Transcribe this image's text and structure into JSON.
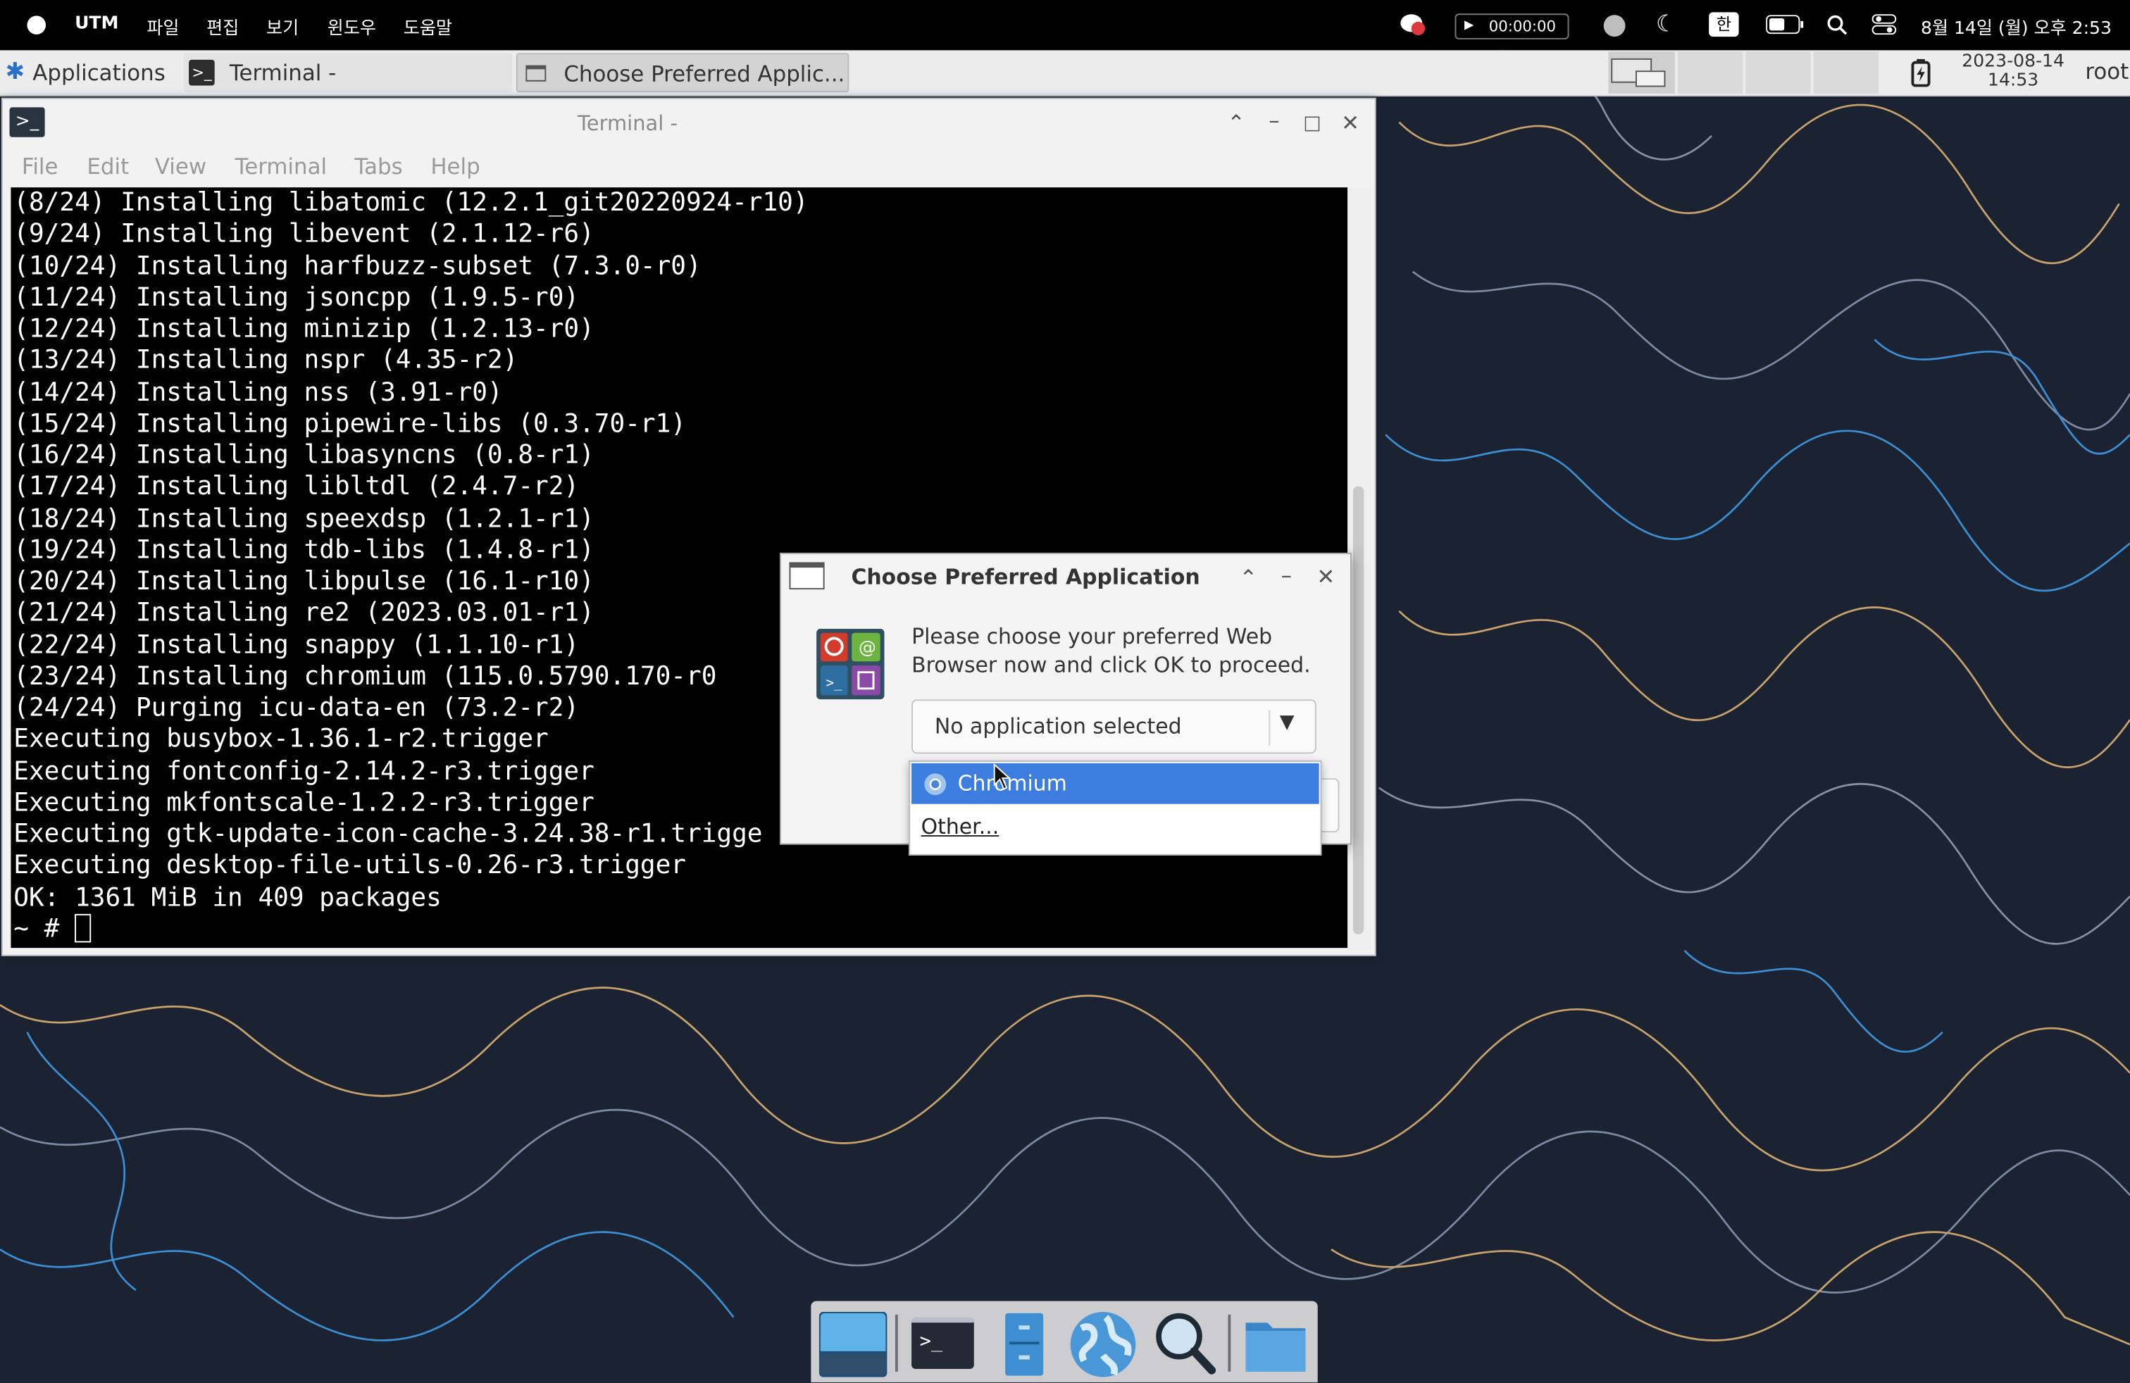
{
  "mac_menubar": {
    "app_name": "UTM",
    "menus": [
      "파일",
      "편집",
      "보기",
      "윈도우",
      "도움말"
    ],
    "timer": "00:00:00",
    "input_method": "한",
    "clock": "8월 14일 (월) 오후 2:53"
  },
  "panel": {
    "applications_label": "Applications",
    "tasks": [
      {
        "label": "Terminal -"
      },
      {
        "label": "Choose Preferred Applic..."
      }
    ],
    "date": "2023-08-14",
    "time": "14:53",
    "user": "root"
  },
  "terminal": {
    "title": "Terminal -",
    "menus": [
      "File",
      "Edit",
      "View",
      "Terminal",
      "Tabs",
      "Help"
    ],
    "lines": [
      "(8/24) Installing libatomic (12.2.1_git20220924-r10)",
      "(9/24) Installing libevent (2.1.12-r6)",
      "(10/24) Installing harfbuzz-subset (7.3.0-r0)",
      "(11/24) Installing jsoncpp (1.9.5-r0)",
      "(12/24) Installing minizip (1.2.13-r0)",
      "(13/24) Installing nspr (4.35-r2)",
      "(14/24) Installing nss (3.91-r0)",
      "(15/24) Installing pipewire-libs (0.3.70-r1)",
      "(16/24) Installing libasyncns (0.8-r1)",
      "(17/24) Installing libltdl (2.4.7-r2)",
      "(18/24) Installing speexdsp (1.2.1-r1)",
      "(19/24) Installing tdb-libs (1.4.8-r1)",
      "(20/24) Installing libpulse (16.1-r10)",
      "(21/24) Installing re2 (2023.03.01-r1)",
      "(22/24) Installing snappy (1.1.10-r1)",
      "(23/24) Installing chromium (115.0.5790.170-r0",
      "(24/24) Purging icu-data-en (73.2-r2)",
      "Executing busybox-1.36.1-r2.trigger",
      "Executing fontconfig-2.14.2-r3.trigger",
      "Executing mkfontscale-1.2.2-r3.trigger",
      "Executing gtk-update-icon-cache-3.24.38-r1.trigge",
      "Executing desktop-file-utils-0.26-r3.trigger",
      "OK: 1361 MiB in 409 packages"
    ],
    "prompt": "~ # "
  },
  "dialog": {
    "title": "Choose Preferred Application",
    "message": "Please choose your preferred Web Browser now and click OK to proceed.",
    "combo_value": "No application selected",
    "options": [
      "Chromium",
      "Other..."
    ]
  }
}
